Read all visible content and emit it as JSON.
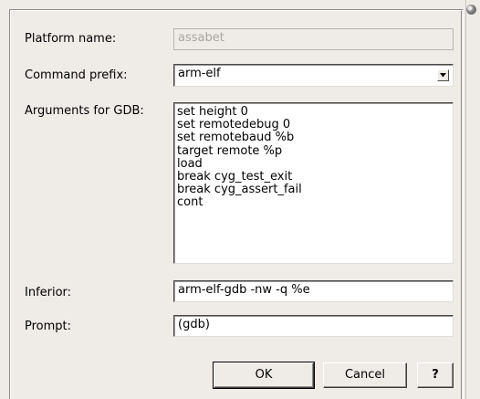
{
  "form": {
    "platform_name": {
      "label": "Platform name:",
      "value": "assabet"
    },
    "command_prefix": {
      "label": "Command prefix:",
      "value": "arm-elf"
    },
    "arguments": {
      "label": "Arguments for GDB:",
      "value": "set height 0\nset remotedebug 0\nset remotebaud %b\ntarget remote %p\nload\nbreak cyg_test_exit\nbreak cyg_assert_fail\ncont"
    },
    "inferior": {
      "label": "Inferior:",
      "value": "arm-elf-gdb -nw -q %e"
    },
    "prompt": {
      "label": "Prompt:",
      "value": "(gdb)"
    }
  },
  "buttons": {
    "ok": "OK",
    "cancel": "Cancel",
    "help": "?"
  },
  "icons": {
    "dropdown": "chevron-down-icon",
    "dock": "dock-handle-icon"
  }
}
